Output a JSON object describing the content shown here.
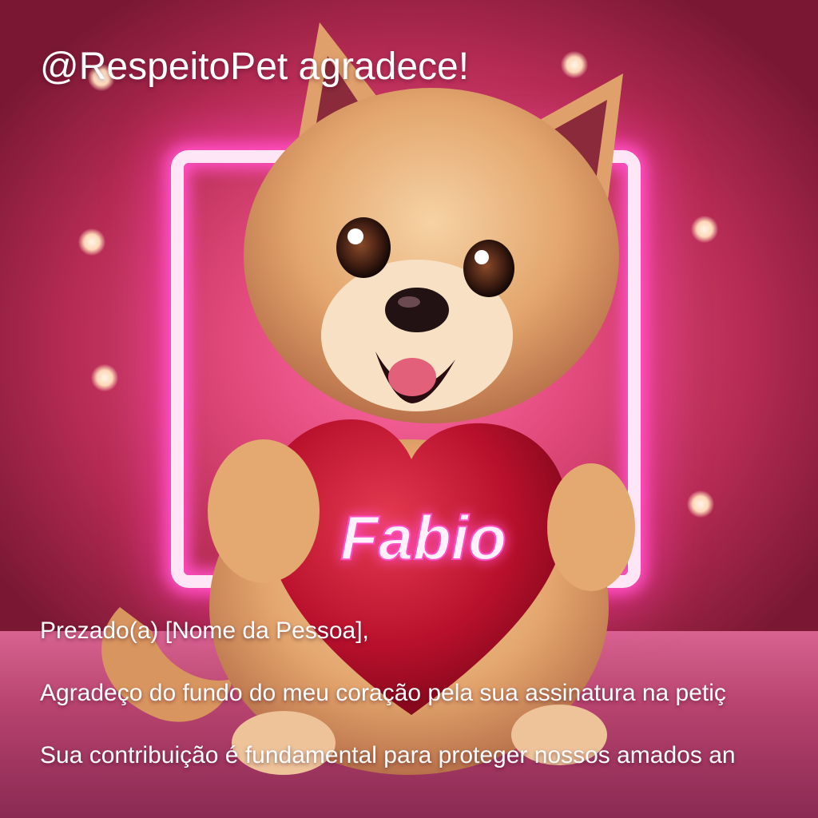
{
  "header": {
    "title": "@RespeitoPet agradece!"
  },
  "heart": {
    "name": "Fabio"
  },
  "letter": {
    "greeting": "Prezado(a) [Nome da Pessoa],",
    "line1": "Agradeço do fundo do meu coração pela sua assinatura na petiç",
    "line2": "Sua contribuição é fundamental para proteger nossos amados an"
  },
  "colors": {
    "neon": "#ff4fc3",
    "heart": "#c3122f",
    "fur": "#e8b27a"
  }
}
